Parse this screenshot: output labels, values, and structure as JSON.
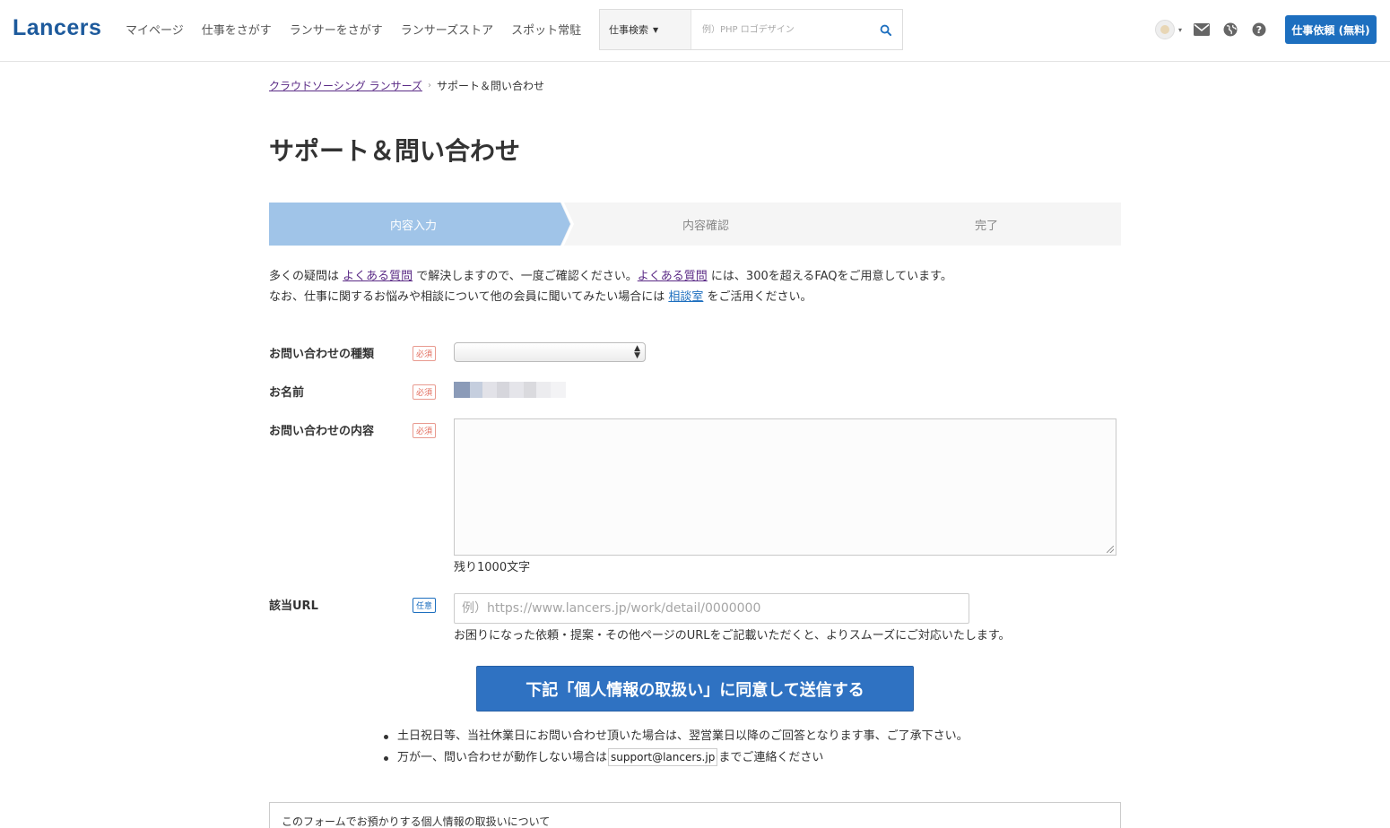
{
  "header": {
    "logo": "Lancers",
    "nav": [
      "マイページ",
      "仕事をさがす",
      "ランサーをさがす",
      "ランサーズストア",
      "スポット常駐"
    ],
    "search_category": "仕事検索",
    "search_placeholder": "例）PHP ロゴデザイン",
    "order_button": "仕事依頼 (無料)"
  },
  "breadcrumb": {
    "home": "クラウドソーシング ランサーズ",
    "current": "サポート＆問い合わせ"
  },
  "page_title": "サポート＆問い合わせ",
  "steps": [
    "内容入力",
    "内容確認",
    "完了"
  ],
  "intro": {
    "line1_a": "多くの疑問は ",
    "faq_link": "よくある質問",
    "line1_b": " で解決しますので、一度ご確認ください。",
    "line1_c": " には、300を超えるFAQをご用意しています。",
    "line2_a": "なお、仕事に関するお悩みや相談について他の会員に聞いてみたい場合には ",
    "consult_link": "相談室",
    "line2_b": " をご活用ください。"
  },
  "form": {
    "type_label": "お問い合わせの種類",
    "name_label": "お名前",
    "content_label": "お問い合わせの内容",
    "url_label": "該当URL",
    "required_badge": "必須",
    "optional_badge": "任意",
    "remaining": "残り1000文字",
    "url_placeholder": "例）https://www.lancers.jp/work/detail/0000000",
    "url_help": "お困りになった依頼・提案・その他ページのURLをご記載いただくと、よりスムーズにご対応いたします。"
  },
  "submit_label": "下記「個人情報の取扱い」に同意して送信する",
  "notes": {
    "note1": "土日祝日等、当社休業日にお問い合わせ頂いた場合は、翌営業日以降のご回答となります事、ご了承下さい。",
    "note2_a": "万が一、問い合わせが動作しない場合は",
    "email": "support@lancers.jp",
    "note2_b": "までご連絡ください"
  },
  "privacy_title": "このフォームでお預かりする個人情報の取扱いについて",
  "colors": {
    "brand": "#1d5a9c",
    "accent": "#1d6fbf",
    "step_active": "#a0c4e8",
    "link_visited": "#5b2b86",
    "required": "#e26a5a"
  },
  "icons": [
    "search-icon",
    "avatar",
    "mail-icon",
    "globe-icon",
    "help-icon"
  ]
}
